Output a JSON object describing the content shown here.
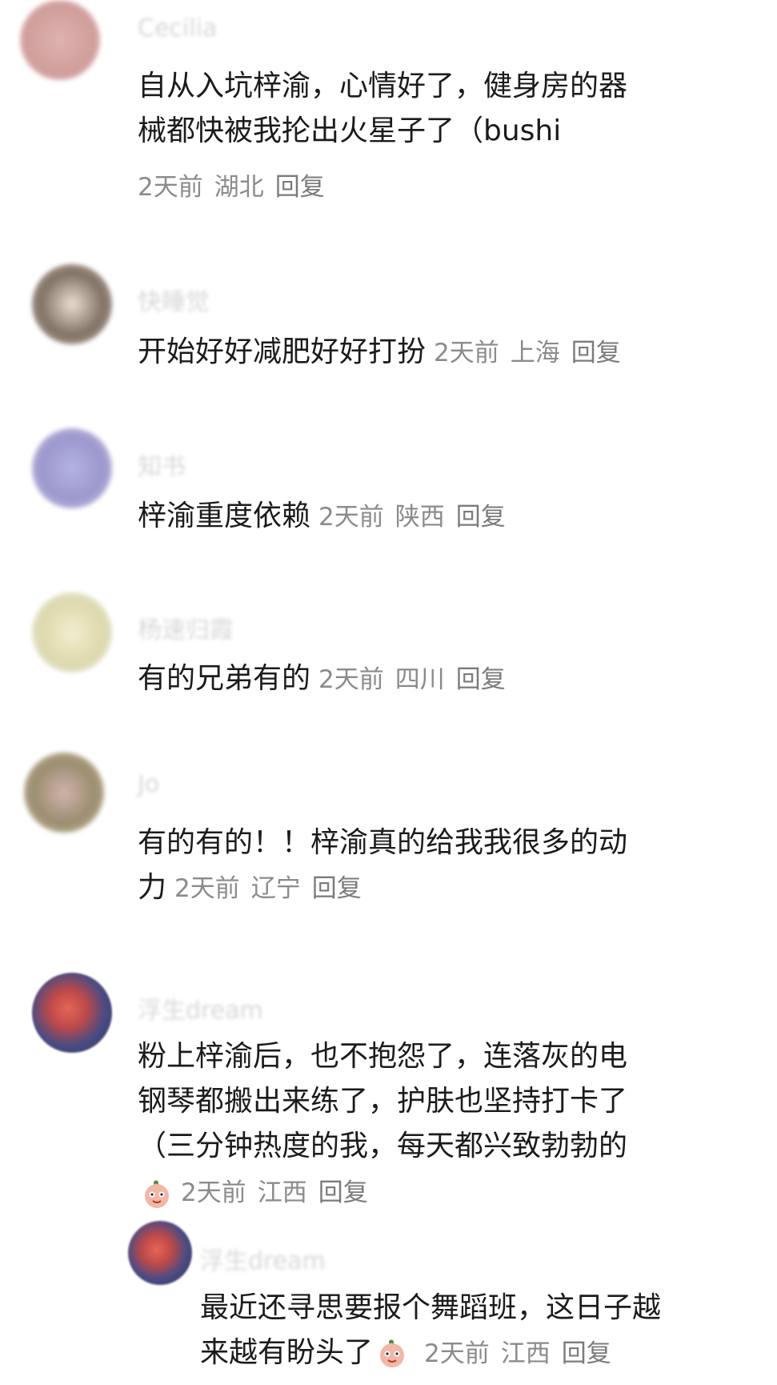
{
  "comments": [
    {
      "user": "Cecilia",
      "lines": [
        "自从入坑梓渝，心情好了，健身房的器",
        "械都快被我抡出火星子了（bushi"
      ],
      "time": "2天前",
      "location": "湖北",
      "reply": "回复",
      "avatar_color": "#c98d8a"
    },
    {
      "user": "快睡觉",
      "lines": [
        "开始好好减肥好好打扮"
      ],
      "time": "2天前",
      "location": "上海",
      "reply": "回复",
      "avatar_color": "#6b5a4a"
    },
    {
      "user": "知书",
      "lines": [
        "梓渝重度依赖"
      ],
      "time": "2天前",
      "location": "陕西",
      "reply": "回复",
      "avatar_color": "#8a86c4"
    },
    {
      "user": "杨速归霞",
      "lines": [
        "有的兄弟有的"
      ],
      "time": "2天前",
      "location": "四川",
      "reply": "回复",
      "avatar_color": "#d9d2a0"
    },
    {
      "user": "Jo",
      "lines": [
        "有的有的！！梓渝真的给我我很多的动",
        "力"
      ],
      "time": "2天前",
      "location": "辽宁",
      "reply": "回复",
      "avatar_color": "#8a7a55"
    },
    {
      "user": "浮生dream",
      "lines": [
        "粉上梓渝后，也不抱怨了，连落灰的电",
        "钢琴都搬出来练了，护肤也坚持打卡了",
        "（三分钟热度的我，每天都兴致勃勃的"
      ],
      "time": "2天前",
      "location": "江西",
      "reply": "回复",
      "avatar_color": "#2a2c6e"
    }
  ],
  "sub_reply": {
    "user": "浮生dream",
    "lines": [
      "最近还寻思要报个舞蹈班，这日子越",
      "来越有盼头了"
    ],
    "time": "2天前",
    "location": "江西",
    "reply": "回复",
    "avatar_color": "#2a2c6e"
  },
  "emoji_name": "peach-emoji"
}
